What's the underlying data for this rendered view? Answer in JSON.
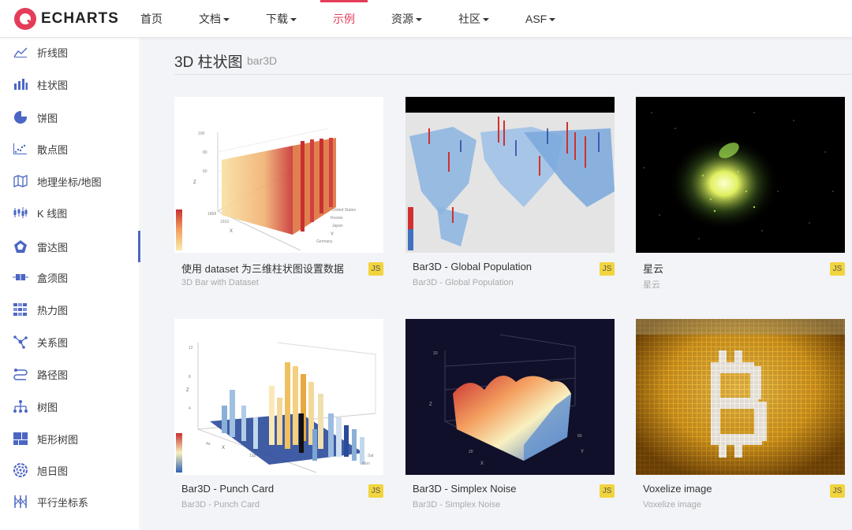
{
  "brand": {
    "logo_text": "ECHARTS",
    "accent": "#e43c59"
  },
  "nav": {
    "items": [
      {
        "label": "首页",
        "dropdown": false,
        "active": false
      },
      {
        "label": "文档",
        "dropdown": true,
        "active": false
      },
      {
        "label": "下载",
        "dropdown": true,
        "active": false
      },
      {
        "label": "示例",
        "dropdown": false,
        "active": true
      },
      {
        "label": "资源",
        "dropdown": true,
        "active": false
      },
      {
        "label": "社区",
        "dropdown": true,
        "active": false
      },
      {
        "label": "ASF",
        "dropdown": true,
        "active": false
      }
    ]
  },
  "sidebar": {
    "items": [
      {
        "label": "折线图",
        "icon": "line-chart-icon"
      },
      {
        "label": "柱状图",
        "icon": "bar-chart-icon"
      },
      {
        "label": "饼图",
        "icon": "pie-chart-icon"
      },
      {
        "label": "散点图",
        "icon": "scatter-chart-icon"
      },
      {
        "label": "地理坐标/地图",
        "icon": "map-icon"
      },
      {
        "label": "K 线图",
        "icon": "candlestick-icon"
      },
      {
        "label": "雷达图",
        "icon": "radar-icon",
        "active": true
      },
      {
        "label": "盒须图",
        "icon": "boxplot-icon"
      },
      {
        "label": "热力图",
        "icon": "heatmap-icon"
      },
      {
        "label": "关系图",
        "icon": "graph-icon"
      },
      {
        "label": "路径图",
        "icon": "lines-icon"
      },
      {
        "label": "树图",
        "icon": "tree-icon"
      },
      {
        "label": "矩形树图",
        "icon": "treemap-icon"
      },
      {
        "label": "旭日图",
        "icon": "sunburst-icon"
      },
      {
        "label": "平行坐标系",
        "icon": "parallel-icon"
      }
    ]
  },
  "section": {
    "title": "3D 柱状图",
    "subtitle": "bar3D"
  },
  "cards": [
    {
      "title": "使用 dataset 为三维柱状图设置数据",
      "subtitle": "3D Bar with Dataset",
      "badge": "JS",
      "thumb": "bar3d-dataset"
    },
    {
      "title": "Bar3D - Global Population",
      "subtitle": "Bar3D - Global Population",
      "badge": "JS",
      "thumb": "global-population"
    },
    {
      "title": "星云",
      "subtitle": "星云",
      "badge": "JS",
      "thumb": "nebula"
    },
    {
      "title": "Bar3D - Punch Card",
      "subtitle": "Bar3D - Punch Card",
      "badge": "JS",
      "thumb": "punch-card"
    },
    {
      "title": "Bar3D - Simplex Noise",
      "subtitle": "Bar3D - Simplex Noise",
      "badge": "JS",
      "thumb": "simplex-noise"
    },
    {
      "title": "Voxelize image",
      "subtitle": "Voxelize image",
      "badge": "JS",
      "thumb": "voxelize-image"
    }
  ]
}
